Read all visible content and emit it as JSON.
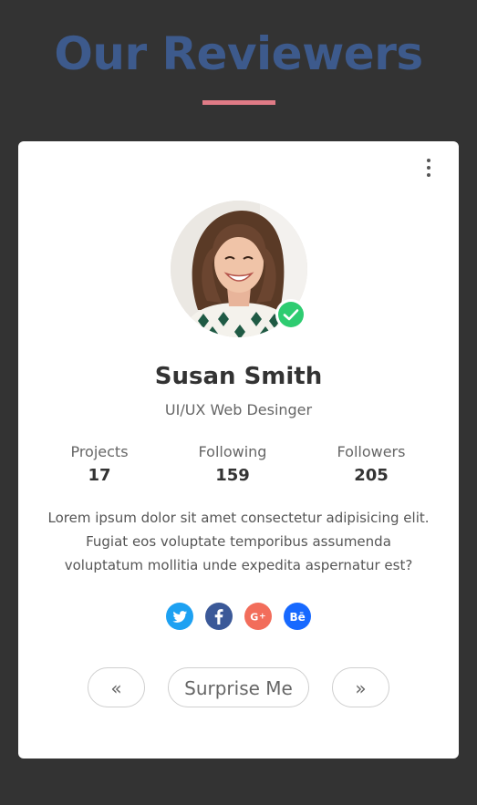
{
  "header": {
    "title": "Our Reviewers"
  },
  "card": {
    "menu_icon": "kebab-vertical-icon",
    "profile": {
      "name": "Susan Smith",
      "role": "UI/UX Web Desinger",
      "verified_icon": "check-circle-icon",
      "verified_color": "#2ecc71"
    },
    "stats": [
      {
        "label": "Projects",
        "value": "17"
      },
      {
        "label": "Following",
        "value": "159"
      },
      {
        "label": "Followers",
        "value": "205"
      }
    ],
    "description": "Lorem ipsum dolor sit amet consectetur adipisicing elit. Fugiat eos voluptate temporibus assumenda voluptatum mollitia unde expedita aspernatur est?",
    "social": [
      {
        "icon": "twitter-icon",
        "color": "#1da1f2"
      },
      {
        "icon": "facebook-icon",
        "color": "#3b5998"
      },
      {
        "icon": "google-plus-icon",
        "color": "#f26d5b"
      },
      {
        "icon": "behance-icon",
        "color": "#1769ff"
      }
    ],
    "buttons": {
      "prev": "«",
      "surprise": "Surprise Me",
      "next": "»"
    }
  },
  "colors": {
    "background": "#333333",
    "title": "#3d5a8c",
    "accent_underline": "#e07b86"
  }
}
